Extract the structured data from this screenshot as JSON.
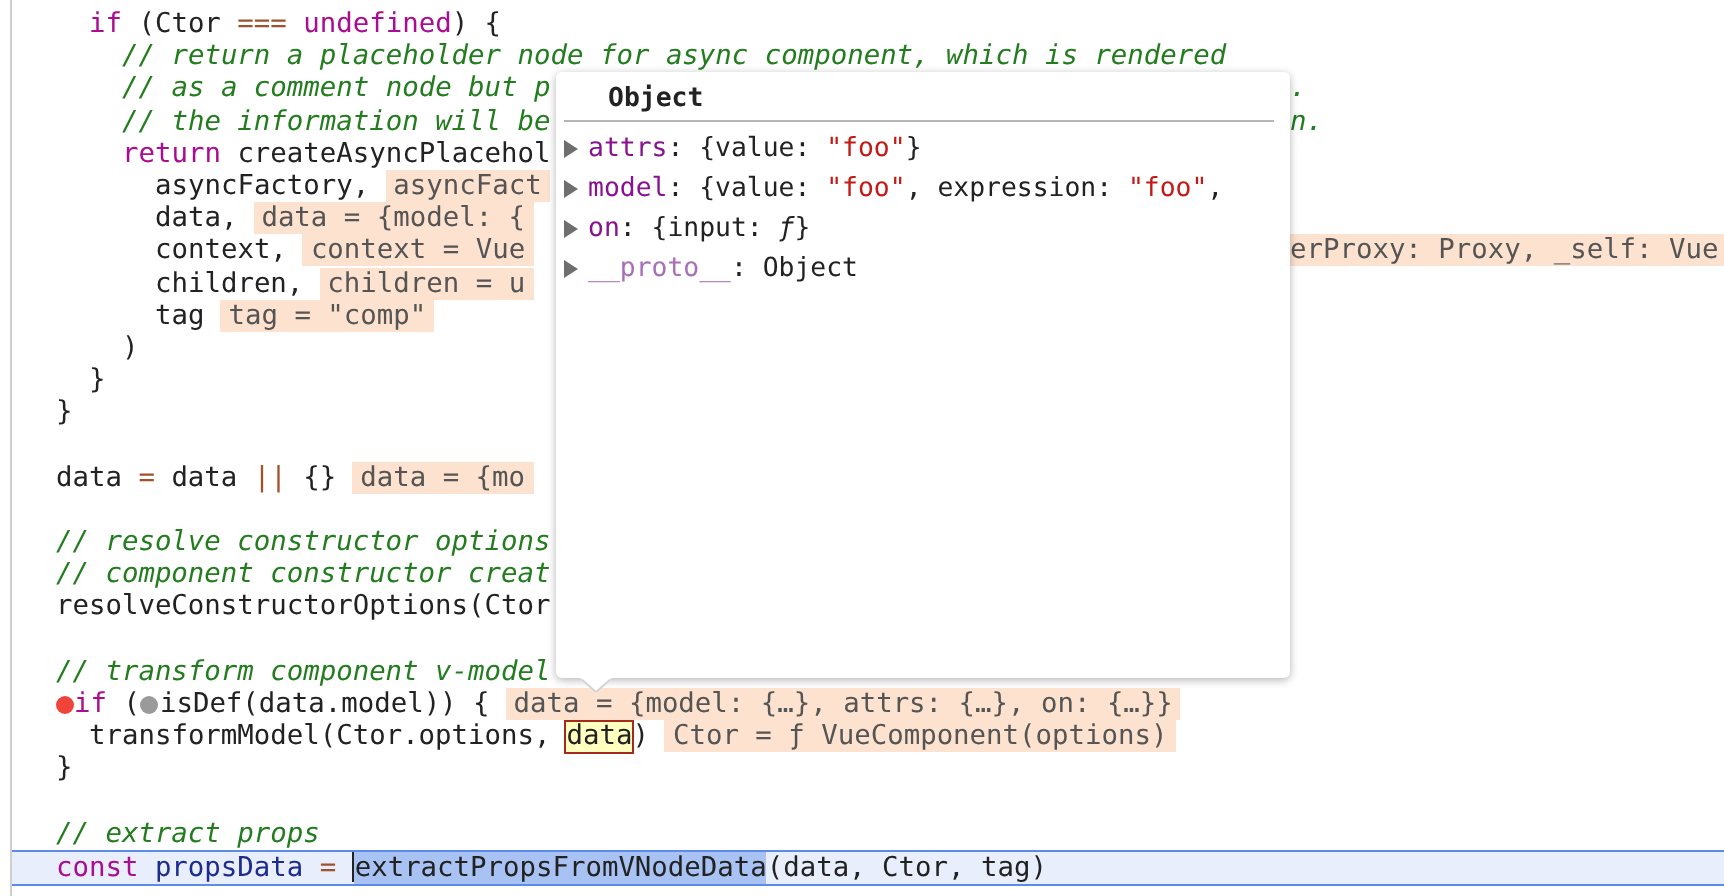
{
  "code_lines": [
    {
      "children": [
        {
          "segments": [
            {
              "kind": "code",
              "tokens": [
                {
                  "kind": "kw",
                  "text": "if"
                },
                {
                  "kind": "tx",
                  "text": " (Ctor "
                },
                {
                  "kind": "op",
                  "text": "==="
                },
                {
                  "kind": "kw",
                  "text": " undefined"
                },
                {
                  "kind": "tx",
                  "text": ") {"
                }
              ]
            }
          ],
          "children": [
            {
              "segments": [
                {
                  "kind": "code",
                  "tokens": [
                    {
                      "kind": "cm",
                      "text": "// return a placeholder node for async component, which is rendered"
                    }
                  ]
                }
              ]
            },
            {
              "segments": [
                {
                  "kind": "code",
                  "tokens": [
                    {
                      "kind": "cm",
                      "text": "// as a comment node but p"
                    }
                  ]
                }
              ],
              "after": [
                {
                  "kind": "code",
                  "tokens": [
                    {
                      "kind": "cm",
                      "text": "."
                    }
                  ]
                }
              ]
            },
            {
              "segments": [
                {
                  "kind": "code",
                  "tokens": [
                    {
                      "kind": "cm",
                      "text": "// the information will be"
                    }
                  ]
                }
              ],
              "after": [
                {
                  "kind": "code",
                  "tokens": [
                    {
                      "kind": "cm",
                      "text": "n."
                    }
                  ]
                }
              ]
            },
            {
              "segments": [
                {
                  "kind": "code",
                  "tokens": [
                    {
                      "kind": "kw",
                      "text": "return"
                    },
                    {
                      "kind": "tx",
                      "text": " createAsyncPlacehol"
                    }
                  ]
                }
              ],
              "children": [
                {
                  "segments": [
                    {
                      "kind": "code",
                      "tokens": [
                        {
                          "kind": "tx",
                          "text": "asyncFactory,"
                        }
                      ]
                    },
                    {
                      "kind": "value",
                      "text": "asyncFact"
                    }
                  ]
                },
                {
                  "segments": [
                    {
                      "kind": "code",
                      "tokens": [
                        {
                          "kind": "tx",
                          "text": "data,"
                        }
                      ]
                    },
                    {
                      "kind": "value",
                      "text": "data = {model: {"
                    }
                  ]
                },
                {
                  "segments": [
                    {
                      "kind": "code",
                      "tokens": [
                        {
                          "kind": "tx",
                          "text": "context,"
                        }
                      ]
                    },
                    {
                      "kind": "value",
                      "text": "context = Vue"
                    }
                  ],
                  "after": [
                    {
                      "kind": "value",
                      "text": "erProxy: Proxy, _self: Vue"
                    }
                  ]
                },
                {
                  "segments": [
                    {
                      "kind": "code",
                      "tokens": [
                        {
                          "kind": "tx",
                          "text": "children,"
                        }
                      ]
                    },
                    {
                      "kind": "value",
                      "text": "children = u"
                    }
                  ]
                },
                {
                  "segments": [
                    {
                      "kind": "code",
                      "tokens": [
                        {
                          "kind": "tx",
                          "text": "tag"
                        }
                      ]
                    },
                    {
                      "kind": "value",
                      "text": "tag = \"comp\""
                    }
                  ]
                }
              ]
            },
            {
              "segments": [
                {
                  "kind": "code",
                  "tokens": [
                    {
                      "kind": "tx",
                      "text": ")"
                    }
                  ]
                }
              ]
            }
          ]
        },
        {
          "segments": [
            {
              "kind": "code",
              "tokens": [
                {
                  "kind": "tx",
                  "text": "}"
                }
              ]
            }
          ]
        }
      ]
    },
    {
      "segments": [
        {
          "kind": "code",
          "tokens": [
            {
              "kind": "tx",
              "text": "}"
            }
          ]
        }
      ]
    },
    {
      "kind": "blank"
    },
    {
      "segments": [
        {
          "kind": "code",
          "tokens": [
            {
              "kind": "tx",
              "text": "data "
            },
            {
              "kind": "op",
              "text": "="
            },
            {
              "kind": "tx",
              "text": " data "
            },
            {
              "kind": "op",
              "text": "||"
            },
            {
              "kind": "tx",
              "text": " {}"
            }
          ]
        },
        {
          "kind": "value",
          "text": "data = {mo"
        }
      ]
    },
    {
      "kind": "blank"
    },
    {
      "segments": [
        {
          "kind": "code",
          "tokens": [
            {
              "kind": "cm",
              "text": "// resolve constructor options"
            }
          ]
        }
      ]
    },
    {
      "segments": [
        {
          "kind": "code",
          "tokens": [
            {
              "kind": "cm",
              "text": "// component constructor creat"
            }
          ]
        }
      ]
    },
    {
      "segments": [
        {
          "kind": "code",
          "tokens": [
            {
              "kind": "tx",
              "text": "resolveConstructorOptions(Ctor"
            }
          ]
        }
      ]
    },
    {
      "kind": "blank"
    },
    {
      "segments": [
        {
          "kind": "code",
          "tokens": [
            {
              "kind": "cm",
              "text": "// transform component v-model"
            }
          ]
        }
      ]
    },
    {
      "segments": [
        {
          "kind": "breakpoint"
        },
        {
          "kind": "code",
          "tokens": [
            {
              "kind": "kw",
              "text": "if"
            },
            {
              "kind": "tx",
              "text": " ("
            }
          ]
        },
        {
          "kind": "marker"
        },
        {
          "kind": "code",
          "tokens": [
            {
              "kind": "tx",
              "text": "isDef(data.model)) {"
            }
          ]
        },
        {
          "kind": "value",
          "text": "data = {model: {…}, attrs: {…}, on: {…}}"
        }
      ],
      "children": [
        {
          "segments": [
            {
              "kind": "code",
              "tokens": [
                {
                  "kind": "tx",
                  "text": "transformModel(Ctor.options,"
                }
              ]
            },
            {
              "kind": "hovered",
              "text": "data"
            },
            {
              "kind": "code",
              "tokens": [
                {
                  "kind": "tx",
                  "text": ")"
                }
              ]
            },
            {
              "kind": "value",
              "text": "Ctor = ƒ VueComponent(options)"
            }
          ]
        }
      ]
    },
    {
      "segments": [
        {
          "kind": "code",
          "tokens": [
            {
              "kind": "tx",
              "text": "}"
            }
          ]
        }
      ]
    },
    {
      "kind": "blank"
    },
    {
      "segments": [
        {
          "kind": "code",
          "tokens": [
            {
              "kind": "cm",
              "text": "// extract props"
            }
          ]
        }
      ]
    },
    {
      "current": true,
      "segments": [
        {
          "kind": "code",
          "tokens": [
            {
              "kind": "kw",
              "text": "const"
            },
            {
              "kind": "var",
              "text": " propsData"
            },
            {
              "kind": "op",
              "text": " = "
            }
          ]
        },
        {
          "kind": "cursor"
        },
        {
          "kind": "selection",
          "text": "extractPropsFromVNodeData"
        },
        {
          "kind": "code",
          "tokens": [
            {
              "kind": "tx",
              "text": "(data, Ctor, tag)"
            }
          ]
        }
      ]
    }
  ],
  "popover": {
    "title": "Object",
    "properties": [
      {
        "key": "attrs",
        "internal": false,
        "expanded": false,
        "value": [
          {
            "kind": "tx",
            "text": ": {value: "
          },
          {
            "kind": "str",
            "text": "\"foo\""
          },
          {
            "kind": "tx",
            "text": "}"
          }
        ]
      },
      {
        "key": "model",
        "internal": false,
        "expanded": false,
        "value": [
          {
            "kind": "tx",
            "text": ": {value: "
          },
          {
            "kind": "str",
            "text": "\"foo\""
          },
          {
            "kind": "tx",
            "text": ", expression: "
          },
          {
            "kind": "str",
            "text": "\"foo\""
          },
          {
            "kind": "tx",
            "text": ","
          }
        ]
      },
      {
        "key": "on",
        "internal": false,
        "expanded": false,
        "value": [
          {
            "kind": "tx",
            "text": ": {input: "
          },
          {
            "kind": "fn",
            "text": "ƒ"
          },
          {
            "kind": "tx",
            "text": "}"
          }
        ]
      },
      {
        "key": "__proto__",
        "internal": true,
        "expanded": false,
        "value": [
          {
            "kind": "tx",
            "text": ": Object"
          }
        ]
      }
    ]
  }
}
